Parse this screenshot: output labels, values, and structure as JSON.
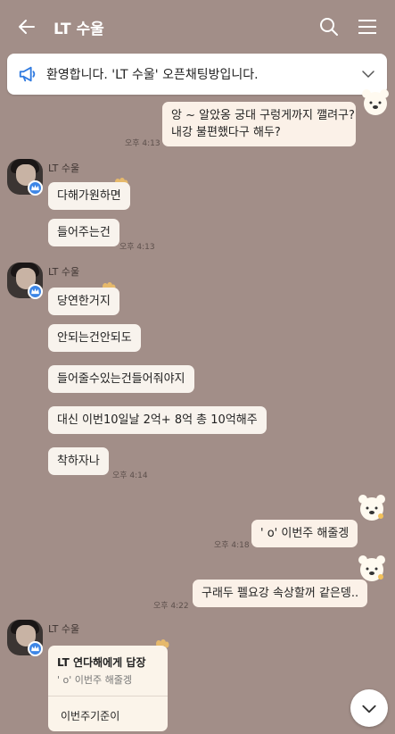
{
  "header": {
    "title": "LT 수울"
  },
  "notice": {
    "text": "환영합니다. 'LT 수울' 오픈채팅방입니다."
  },
  "messages_mine_1": {
    "line1": "앙 ~ 알았옹 궁대 구렁게까지 깰려구?",
    "line2": "내강 불편했다구 해두?",
    "time": "오후 4:13"
  },
  "sender_1": {
    "name": "LT 수울",
    "msg1": "다해가원하면",
    "msg2": "들어주는건",
    "time": "오후 4:13"
  },
  "sender_2": {
    "name": "LT 수울",
    "msg1": "당연한거지",
    "msg2": "안되는건안되도",
    "msg3": "들어줄수있는건들어줘야지",
    "msg4": "대신 이번10일날 2억+ 8억 총 10억해주",
    "msg5": "착하자나",
    "time": "오후 4:14"
  },
  "mine_2": {
    "text": "' o' 이번주 해줄겡",
    "time": "오후 4:18"
  },
  "mine_3": {
    "text": "구래두 펠요강 속상할꺼 같은뎅..",
    "time": "오후 4:22"
  },
  "sender_3": {
    "name": "LT 수울",
    "reply_title": "LT 연다해에게 답장",
    "reply_quote": "' o' 이번주 해줄겡",
    "reply_msg": "이번주기준이"
  }
}
